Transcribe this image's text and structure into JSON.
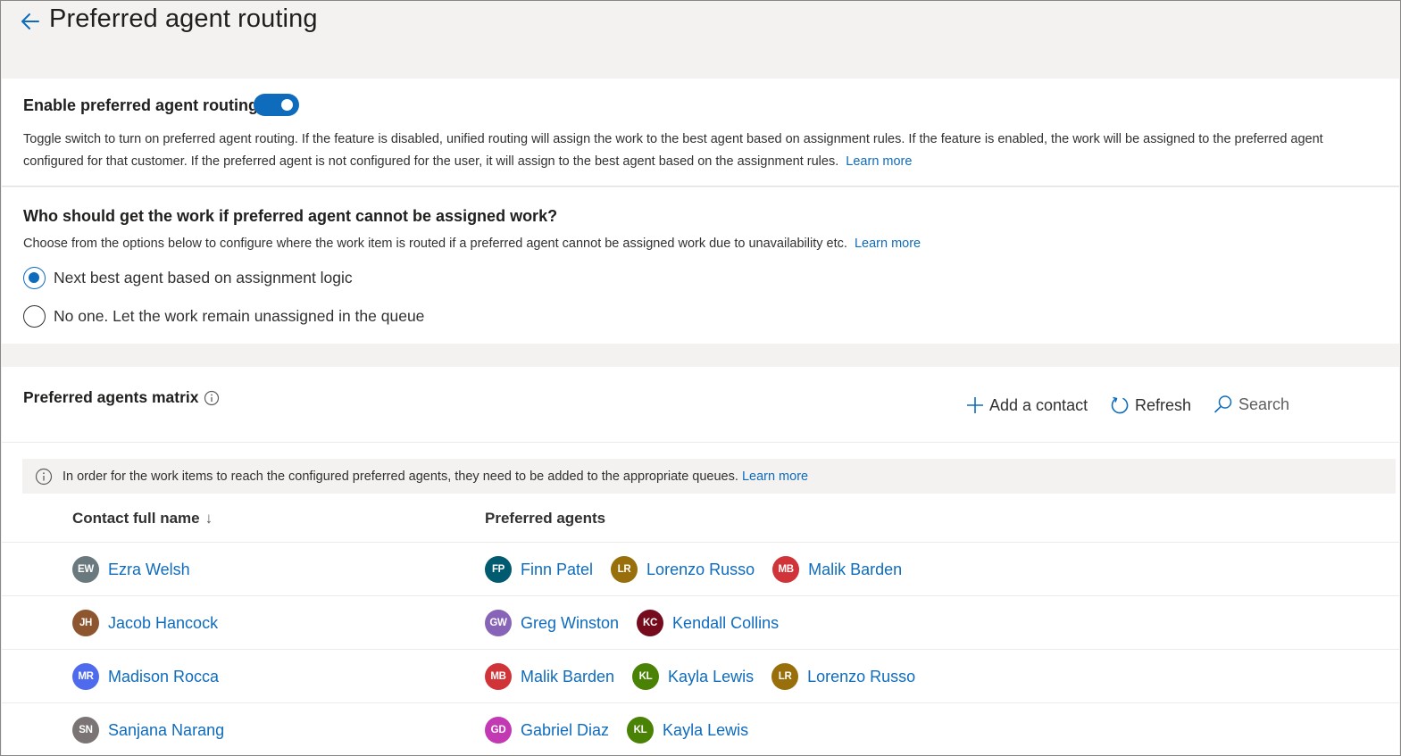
{
  "header": {
    "title": "Preferred agent routing"
  },
  "enable_section": {
    "label": "Enable preferred agent routing",
    "toggle_on": true,
    "description": "Toggle switch to turn on preferred agent routing. If the feature is disabled, unified routing will assign the work to the best agent based on assignment rules. If the feature is enabled, the work will be assigned to the preferred agent configured for that customer. If the preferred agent is not configured for the user, it will assign to the best agent based on the assignment rules.",
    "learn_more": "Learn more"
  },
  "fallback_section": {
    "title": "Who should get the work if preferred agent cannot be assigned work?",
    "description": "Choose from the options below to configure where the work item is routed if a preferred agent cannot be assigned work due to unavailability etc.",
    "learn_more": "Learn more",
    "options": [
      {
        "label": "Next best agent based on assignment logic",
        "selected": true
      },
      {
        "label": "No one. Let the work remain unassigned in the queue",
        "selected": false
      }
    ]
  },
  "matrix": {
    "title": "Preferred agents matrix",
    "commands": {
      "add": "Add a contact",
      "refresh": "Refresh",
      "search": "Search"
    },
    "notice": "In order for the work items to reach the configured preferred agents, they need to be added to the appropriate queues.",
    "notice_link": "Learn more",
    "columns": {
      "contact": "Contact full name",
      "agents": "Preferred agents",
      "sort_indicator": "↓"
    },
    "rows": [
      {
        "contact": {
          "initials": "EW",
          "name": "Ezra Welsh",
          "color": "#69797e"
        },
        "agents": [
          {
            "initials": "FP",
            "name": "Finn Patel",
            "color": "#005b70"
          },
          {
            "initials": "LR",
            "name": "Lorenzo Russo",
            "color": "#986f0b"
          },
          {
            "initials": "MB",
            "name": "Malik Barden",
            "color": "#d13438"
          }
        ]
      },
      {
        "contact": {
          "initials": "JH",
          "name": "Jacob Hancock",
          "color": "#8e562e"
        },
        "agents": [
          {
            "initials": "GW",
            "name": "Greg Winston",
            "color": "#8764b8"
          },
          {
            "initials": "KC",
            "name": "Kendall Collins",
            "color": "#750b1c"
          }
        ]
      },
      {
        "contact": {
          "initials": "MR",
          "name": "Madison Rocca",
          "color": "#4f6bed"
        },
        "agents": [
          {
            "initials": "MB",
            "name": "Malik Barden",
            "color": "#d13438"
          },
          {
            "initials": "KL",
            "name": "Kayla Lewis",
            "color": "#498205"
          },
          {
            "initials": "LR",
            "name": "Lorenzo Russo",
            "color": "#986f0b"
          }
        ]
      },
      {
        "contact": {
          "initials": "SN",
          "name": "Sanjana Narang",
          "color": "#7a7574"
        },
        "agents": [
          {
            "initials": "GD",
            "name": "Gabriel Diaz",
            "color": "#c239b3"
          },
          {
            "initials": "KL",
            "name": "Kayla Lewis",
            "color": "#498205"
          }
        ]
      }
    ]
  },
  "colors": {
    "accent": "#0f6cbd",
    "page_background": "#f3f2f1"
  }
}
